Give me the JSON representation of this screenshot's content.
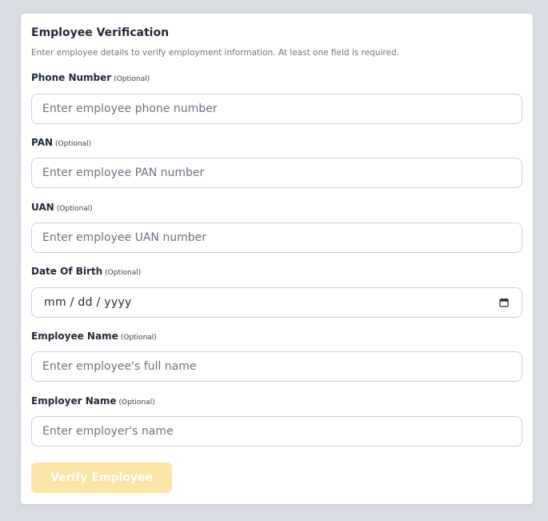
{
  "form": {
    "title": "Employee Verification",
    "subtitle": "Enter employee details to verify employment information. At least one field is required.",
    "optional_tag": "(Optional)",
    "fields": [
      {
        "label": "Phone Number",
        "placeholder": "Enter employee phone number"
      },
      {
        "label": "PAN",
        "placeholder": "Enter employee PAN number"
      },
      {
        "label": "UAN",
        "placeholder": "Enter employee UAN number"
      },
      {
        "label": "Date Of Birth",
        "value": "mm / dd / yyyy"
      },
      {
        "label": "Employee Name",
        "placeholder": "Enter employee's full name"
      },
      {
        "label": "Employer Name",
        "placeholder": "Enter employer's name"
      }
    ],
    "submit_label": "Verify Employee"
  },
  "colors": {
    "page_bg": "#d9dce3",
    "card_bg": "#ffffff",
    "button_disabled_bg": "#fde4a7",
    "button_text": "#ffffff"
  },
  "icons": {
    "date_picker": "calendar-icon"
  }
}
